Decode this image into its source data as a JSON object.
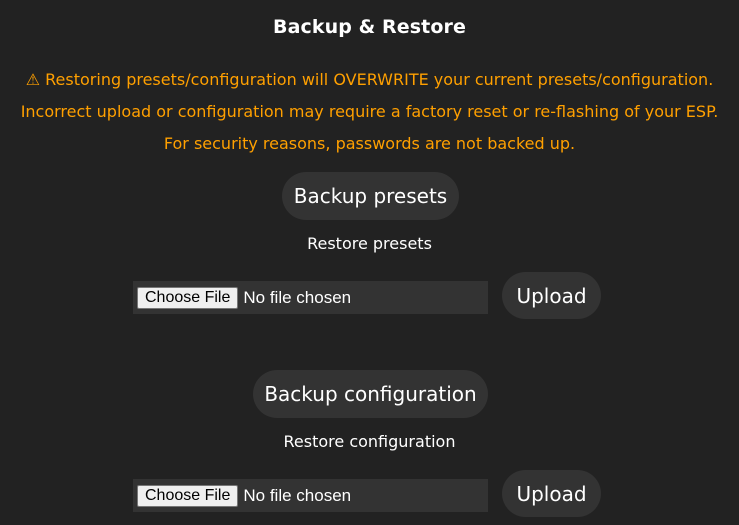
{
  "header": {
    "title": "Backup & Restore"
  },
  "warnings": {
    "line1": "⚠ Restoring presets/configuration will OVERWRITE your current presets/configuration.",
    "line2": "Incorrect upload or configuration may require a factory reset or re-flashing of your ESP.",
    "line3": "For security reasons, passwords are not backed up."
  },
  "presets": {
    "backup_label": "Backup presets",
    "restore_label": "Restore presets",
    "choose_label": "Choose File",
    "file_status": "No file chosen",
    "upload_label": "Upload"
  },
  "config": {
    "backup_label": "Backup configuration",
    "restore_label": "Restore configuration",
    "choose_label": "Choose File",
    "file_status": "No file chosen",
    "upload_label": "Upload"
  },
  "colors": {
    "background": "#222222",
    "warning": "#ffa000",
    "button": "#333333"
  }
}
